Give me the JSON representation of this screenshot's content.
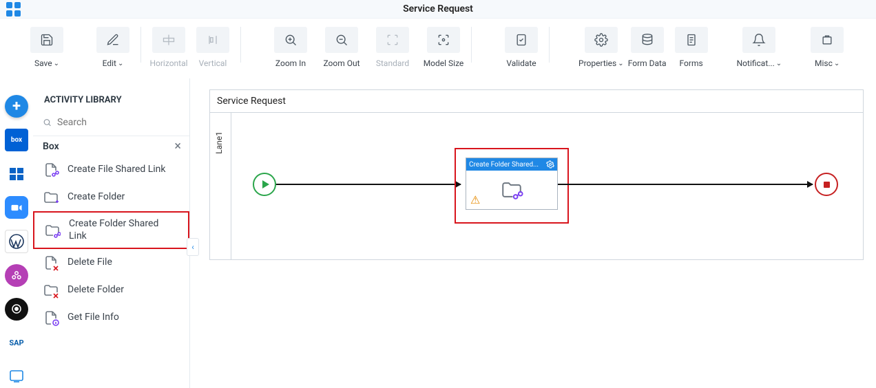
{
  "header": {
    "title": "Service Request"
  },
  "toolbar": {
    "save": "Save",
    "edit": "Edit",
    "horizontal": "Horizontal",
    "vertical": "Vertical",
    "zoom_in": "Zoom In",
    "zoom_out": "Zoom Out",
    "standard": "Standard",
    "model_size": "Model Size",
    "validate": "Validate",
    "properties": "Properties",
    "form_data": "Form Data",
    "forms": "Forms",
    "notifications": "Notificat...",
    "misc": "Misc"
  },
  "library": {
    "title": "ACTIVITY LIBRARY",
    "search_placeholder": "Search",
    "category": "Box",
    "items": [
      {
        "label": "Create File Shared Link"
      },
      {
        "label": "Create Folder"
      },
      {
        "label": "Create Folder Shared Link"
      },
      {
        "label": "Delete File"
      },
      {
        "label": "Delete Folder"
      },
      {
        "label": "Get File Info"
      }
    ]
  },
  "canvas": {
    "title": "Service Request",
    "lane": "Lane1",
    "activity_label": "Create Folder Shared..."
  }
}
